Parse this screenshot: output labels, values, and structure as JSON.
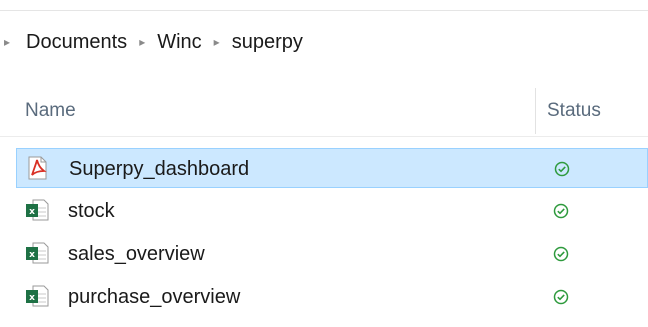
{
  "breadcrumb": {
    "items": [
      {
        "label": "Documents"
      },
      {
        "label": "Winc"
      },
      {
        "label": "superpy"
      }
    ]
  },
  "columns": {
    "name": "Name",
    "status": "Status"
  },
  "files": [
    {
      "name": "Superpy_dashboard",
      "icon": "pdf-icon",
      "status_icon": "synced-check-icon",
      "selected": true
    },
    {
      "name": "stock",
      "icon": "excel-icon",
      "status_icon": "synced-check-icon",
      "selected": false
    },
    {
      "name": "sales_overview",
      "icon": "excel-icon",
      "status_icon": "synced-check-icon",
      "selected": false
    },
    {
      "name": "purchase_overview",
      "icon": "excel-icon",
      "status_icon": "synced-check-icon",
      "selected": false
    }
  ],
  "colors": {
    "selection_bg": "#cce8ff",
    "selection_border": "#99d1ff",
    "status_green": "#2e9a3d",
    "pdf_red": "#d93025",
    "excel_green": "#1e7145"
  }
}
